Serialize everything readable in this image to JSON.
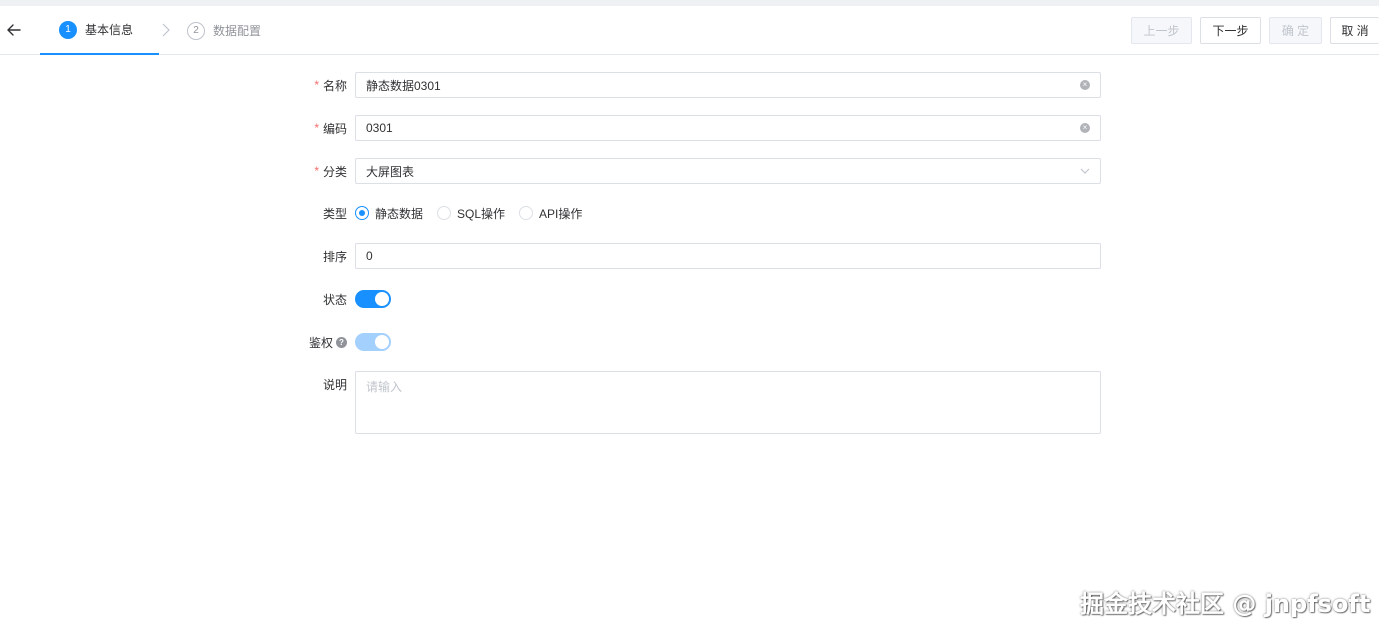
{
  "header": {
    "steps": [
      {
        "number": "1",
        "label": "基本信息",
        "active": true
      },
      {
        "number": "2",
        "label": "数据配置",
        "active": false
      }
    ],
    "buttons": {
      "prev": "上一步",
      "next": "下一步",
      "ok": "确 定",
      "cancel": "取 消"
    }
  },
  "form": {
    "name": {
      "label": "名称",
      "required": true,
      "value": "静态数据0301"
    },
    "code": {
      "label": "编码",
      "required": true,
      "value": "0301"
    },
    "category": {
      "label": "分类",
      "required": true,
      "value": "大屏图表"
    },
    "type": {
      "label": "类型",
      "options": [
        "静态数据",
        "SQL操作",
        "API操作"
      ],
      "selected": "静态数据"
    },
    "sort": {
      "label": "排序",
      "value": "0"
    },
    "status": {
      "label": "状态",
      "on": true
    },
    "auth": {
      "label": "鉴权",
      "help": "?",
      "on": true,
      "disabled": true
    },
    "description": {
      "label": "说明",
      "placeholder": "请输入",
      "value": ""
    }
  },
  "watermark": "掘金技术社区 @ jnpfsoft",
  "colors": {
    "primary": "#1890ff",
    "required": "#f56c6c",
    "border": "#dcdfe6"
  }
}
